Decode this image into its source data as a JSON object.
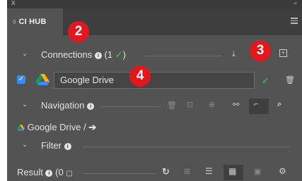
{
  "window": {
    "close_glyph": "x",
    "collapse_glyph": "‹‹"
  },
  "tab": {
    "icon": "diamond-icon",
    "label": "CI HUB"
  },
  "badges": {
    "b2": "2",
    "b3": "3",
    "b4": "4"
  },
  "connections": {
    "label": "Connections",
    "count_text": "(1",
    "close_paren": ")"
  },
  "drive": {
    "value": "Google Drive"
  },
  "navigation": {
    "label": "Navigation"
  },
  "breadcrumb": {
    "text": "Google Drive /"
  },
  "filter": {
    "label": "Filter"
  },
  "result": {
    "label": "Result",
    "count_text": "(0"
  },
  "colors": {
    "panel": "#535353",
    "accent_red": "#e3171e",
    "check_green": "#3db34a",
    "checkbox_blue": "#3d8bf0"
  }
}
